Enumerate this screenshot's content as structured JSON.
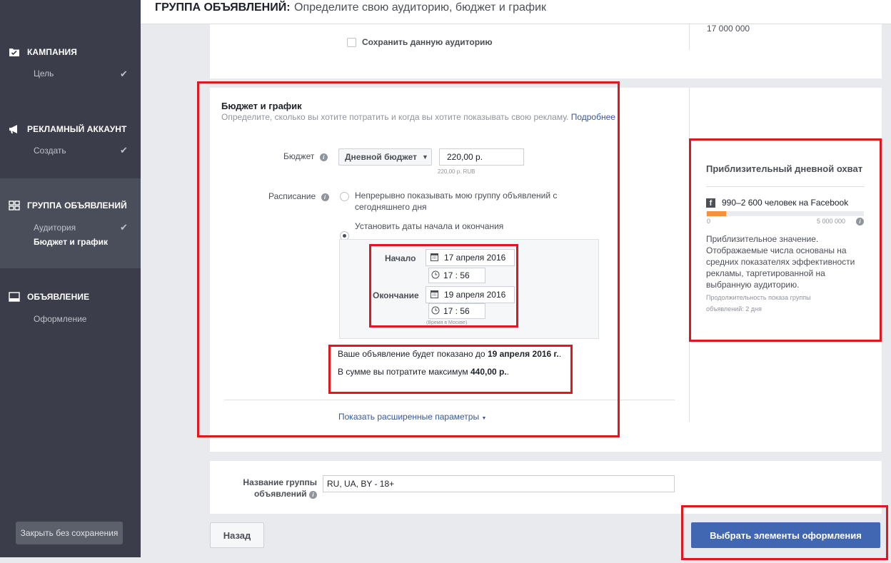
{
  "header": {
    "title_bold": "ГРУППА ОБЪЯВЛЕНИЙ:",
    "title_rest": "Определите свою аудиторию, бюджет и график"
  },
  "sidebar": {
    "sections": [
      {
        "label": "КАМПАНИЯ",
        "icon": "campaign-icon",
        "items": [
          {
            "label": "Цель",
            "checked": true
          }
        ]
      },
      {
        "label": "РЕКЛАМНЫЙ АККАУНТ",
        "icon": "megaphone-icon",
        "items": [
          {
            "label": "Создать",
            "checked": true
          }
        ]
      },
      {
        "label": "ГРУППА ОБЪЯВЛЕНИЙ",
        "icon": "grid-icon",
        "items": [
          {
            "label": "Аудитория",
            "checked": true
          },
          {
            "label": "Бюджет и график",
            "checked": false,
            "active": true
          }
        ]
      },
      {
        "label": "ОБЪЯВЛЕНИЕ",
        "icon": "monitor-icon",
        "items": [
          {
            "label": "Оформление",
            "checked": false
          }
        ]
      }
    ],
    "close_button": "Закрыть без сохранения"
  },
  "audience": {
    "save_label": "Сохранить данную аудиторию",
    "size_value": "17 000 000"
  },
  "budget": {
    "title": "Бюджет и график",
    "description": "Определите, сколько вы хотите потратить и когда вы хотите показывать свою рекламу.",
    "learn_more": "Подробнее",
    "budget_label": "Бюджет",
    "budget_type": "Дневной бюджет",
    "budget_value": "220,00 р.",
    "budget_note": "220,00 р. RUB",
    "schedule_label": "Расписание",
    "schedule_option1": "Непрерывно показывать мою группу объявлений с сегодняшнего дня",
    "schedule_option2": "Установить даты начала и окончания",
    "start_label": "Начало",
    "start_date": "17 апреля 2016",
    "start_time": "17 : 56",
    "end_label": "Окончание",
    "end_date": "19 апреля 2016",
    "end_time": "17 : 56",
    "timezone_note": "(Время в Москве)",
    "summary_line1_prefix": "Ваше объявление будет показано до",
    "summary_line1_bold": "19 апреля 2016 г.",
    "summary_line1_suffix": ".",
    "summary_line2_prefix": "В сумме вы потратите максимум",
    "summary_line2_bold": "440,00 р.",
    "summary_line2_suffix": ".",
    "advanced_link": "Показать расширенные параметры"
  },
  "reach": {
    "title": "Приблизительный дневной охват",
    "count": "990–2 600 человек на Facebook",
    "progress_fraction": 0.12,
    "scale_min": "0",
    "scale_max": "5 000 000",
    "note": "Приблизительное значение. Отображаемые числа основаны на средних показателях эффективности рекламы, таргетированной на выбранную аудиторию.",
    "duration_line1": "Продолжительность показа группы",
    "duration_line2": "объявлений: 2 дня"
  },
  "adset_name": {
    "label_line1": "Название группы",
    "label_line2": "объявлений",
    "value": "RU, UA, BY - 18+"
  },
  "footer": {
    "back": "Назад",
    "next": "Выбрать элементы оформления"
  },
  "colors": {
    "sidebar_bg": "#3b3e4a",
    "highlight": "#e0171e",
    "primary": "#4267b2",
    "link": "#365899",
    "progress": "#f7923b"
  }
}
